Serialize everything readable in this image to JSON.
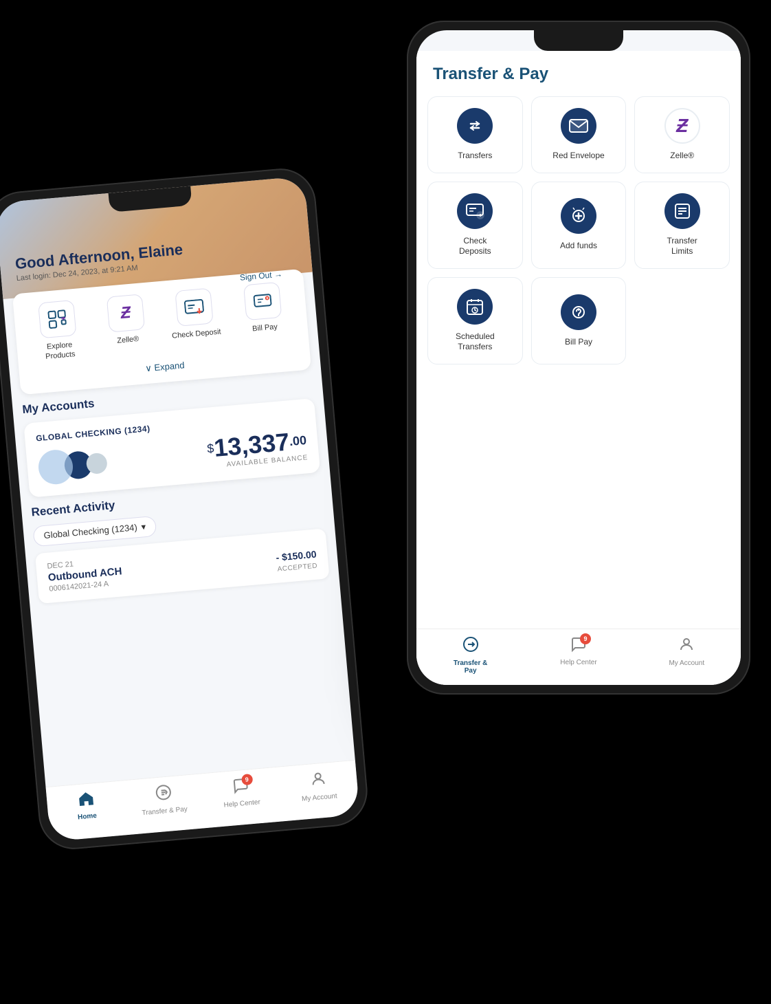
{
  "phone1": {
    "greeting": "Good Afternoon, Elaine",
    "lastLogin": "Last login: Dec 24, 2023, at 9:21 AM",
    "signOut": "Sign Out →",
    "quickLinks": [
      {
        "label": "Explore\nProducts",
        "icon": "⊞"
      },
      {
        "label": "Zelle®",
        "icon": "Ƶ"
      },
      {
        "label": "Check Deposit",
        "icon": "📋"
      },
      {
        "label": "Bill Pay",
        "icon": "💳"
      }
    ],
    "expand": "∨ Expand",
    "myAccounts": "My Accounts",
    "accountName": "GLOBAL CHECKING (1234)",
    "balanceDollar": "$",
    "balanceMain": "13,337",
    "balanceCents": ".00",
    "balanceLabel": "AVAILABLE BALANCE",
    "recentActivity": "Recent Activity",
    "dropdownLabel": "Global Checking (1234)",
    "transaction": {
      "date": "DEC 21",
      "name": "Outbound ACH",
      "amount": "- $150.00",
      "ref": "0006142021-24 A",
      "status": "ACCEPTED"
    },
    "nav": [
      {
        "label": "Home",
        "active": true
      },
      {
        "label": "Transfer & Pay",
        "active": false
      },
      {
        "label": "Help Center",
        "active": false,
        "badge": "9"
      },
      {
        "label": "My Account",
        "active": false
      }
    ]
  },
  "phone2": {
    "title": "Transfer & Pay",
    "gridItems": [
      {
        "label": "Transfers",
        "iconType": "transfers"
      },
      {
        "label": "Red Envelope",
        "iconType": "envelope"
      },
      {
        "label": "Zelle®",
        "iconType": "zelle"
      },
      {
        "label": "Check\nDeposits",
        "iconType": "check"
      },
      {
        "label": "Add funds",
        "iconType": "addfunds"
      },
      {
        "label": "Transfer\nLimits",
        "iconType": "limits"
      },
      {
        "label": "Scheduled\nTransfers",
        "iconType": "scheduled"
      },
      {
        "label": "Bill Pay",
        "iconType": "billpay"
      }
    ],
    "nav": [
      {
        "label": "Transfer & Pay",
        "active": true
      },
      {
        "label": "Help Center",
        "active": false,
        "badge": "9"
      },
      {
        "label": "My Account",
        "active": false
      }
    ]
  }
}
